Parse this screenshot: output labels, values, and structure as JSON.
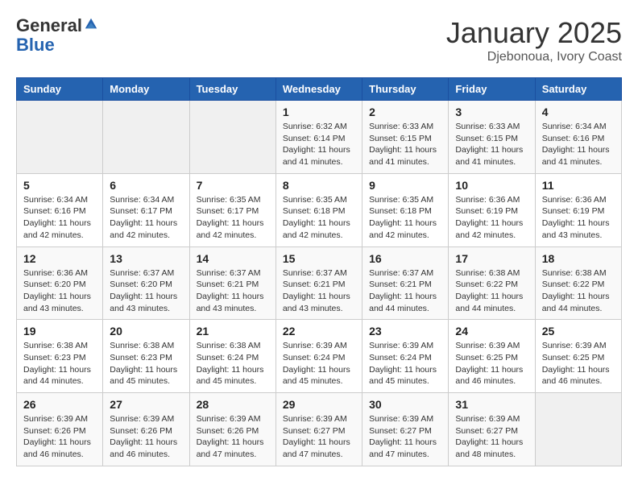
{
  "header": {
    "logo_line1": "General",
    "logo_line2": "Blue",
    "month_title": "January 2025",
    "subtitle": "Djebonoua, Ivory Coast"
  },
  "days_of_week": [
    "Sunday",
    "Monday",
    "Tuesday",
    "Wednesday",
    "Thursday",
    "Friday",
    "Saturday"
  ],
  "weeks": [
    [
      {
        "day": "",
        "info": ""
      },
      {
        "day": "",
        "info": ""
      },
      {
        "day": "",
        "info": ""
      },
      {
        "day": "1",
        "info": "Sunrise: 6:32 AM\nSunset: 6:14 PM\nDaylight: 11 hours\nand 41 minutes."
      },
      {
        "day": "2",
        "info": "Sunrise: 6:33 AM\nSunset: 6:15 PM\nDaylight: 11 hours\nand 41 minutes."
      },
      {
        "day": "3",
        "info": "Sunrise: 6:33 AM\nSunset: 6:15 PM\nDaylight: 11 hours\nand 41 minutes."
      },
      {
        "day": "4",
        "info": "Sunrise: 6:34 AM\nSunset: 6:16 PM\nDaylight: 11 hours\nand 41 minutes."
      }
    ],
    [
      {
        "day": "5",
        "info": "Sunrise: 6:34 AM\nSunset: 6:16 PM\nDaylight: 11 hours\nand 42 minutes."
      },
      {
        "day": "6",
        "info": "Sunrise: 6:34 AM\nSunset: 6:17 PM\nDaylight: 11 hours\nand 42 minutes."
      },
      {
        "day": "7",
        "info": "Sunrise: 6:35 AM\nSunset: 6:17 PM\nDaylight: 11 hours\nand 42 minutes."
      },
      {
        "day": "8",
        "info": "Sunrise: 6:35 AM\nSunset: 6:18 PM\nDaylight: 11 hours\nand 42 minutes."
      },
      {
        "day": "9",
        "info": "Sunrise: 6:35 AM\nSunset: 6:18 PM\nDaylight: 11 hours\nand 42 minutes."
      },
      {
        "day": "10",
        "info": "Sunrise: 6:36 AM\nSunset: 6:19 PM\nDaylight: 11 hours\nand 42 minutes."
      },
      {
        "day": "11",
        "info": "Sunrise: 6:36 AM\nSunset: 6:19 PM\nDaylight: 11 hours\nand 43 minutes."
      }
    ],
    [
      {
        "day": "12",
        "info": "Sunrise: 6:36 AM\nSunset: 6:20 PM\nDaylight: 11 hours\nand 43 minutes."
      },
      {
        "day": "13",
        "info": "Sunrise: 6:37 AM\nSunset: 6:20 PM\nDaylight: 11 hours\nand 43 minutes."
      },
      {
        "day": "14",
        "info": "Sunrise: 6:37 AM\nSunset: 6:21 PM\nDaylight: 11 hours\nand 43 minutes."
      },
      {
        "day": "15",
        "info": "Sunrise: 6:37 AM\nSunset: 6:21 PM\nDaylight: 11 hours\nand 43 minutes."
      },
      {
        "day": "16",
        "info": "Sunrise: 6:37 AM\nSunset: 6:21 PM\nDaylight: 11 hours\nand 44 minutes."
      },
      {
        "day": "17",
        "info": "Sunrise: 6:38 AM\nSunset: 6:22 PM\nDaylight: 11 hours\nand 44 minutes."
      },
      {
        "day": "18",
        "info": "Sunrise: 6:38 AM\nSunset: 6:22 PM\nDaylight: 11 hours\nand 44 minutes."
      }
    ],
    [
      {
        "day": "19",
        "info": "Sunrise: 6:38 AM\nSunset: 6:23 PM\nDaylight: 11 hours\nand 44 minutes."
      },
      {
        "day": "20",
        "info": "Sunrise: 6:38 AM\nSunset: 6:23 PM\nDaylight: 11 hours\nand 45 minutes."
      },
      {
        "day": "21",
        "info": "Sunrise: 6:38 AM\nSunset: 6:24 PM\nDaylight: 11 hours\nand 45 minutes."
      },
      {
        "day": "22",
        "info": "Sunrise: 6:39 AM\nSunset: 6:24 PM\nDaylight: 11 hours\nand 45 minutes."
      },
      {
        "day": "23",
        "info": "Sunrise: 6:39 AM\nSunset: 6:24 PM\nDaylight: 11 hours\nand 45 minutes."
      },
      {
        "day": "24",
        "info": "Sunrise: 6:39 AM\nSunset: 6:25 PM\nDaylight: 11 hours\nand 46 minutes."
      },
      {
        "day": "25",
        "info": "Sunrise: 6:39 AM\nSunset: 6:25 PM\nDaylight: 11 hours\nand 46 minutes."
      }
    ],
    [
      {
        "day": "26",
        "info": "Sunrise: 6:39 AM\nSunset: 6:26 PM\nDaylight: 11 hours\nand 46 minutes."
      },
      {
        "day": "27",
        "info": "Sunrise: 6:39 AM\nSunset: 6:26 PM\nDaylight: 11 hours\nand 46 minutes."
      },
      {
        "day": "28",
        "info": "Sunrise: 6:39 AM\nSunset: 6:26 PM\nDaylight: 11 hours\nand 47 minutes."
      },
      {
        "day": "29",
        "info": "Sunrise: 6:39 AM\nSunset: 6:27 PM\nDaylight: 11 hours\nand 47 minutes."
      },
      {
        "day": "30",
        "info": "Sunrise: 6:39 AM\nSunset: 6:27 PM\nDaylight: 11 hours\nand 47 minutes."
      },
      {
        "day": "31",
        "info": "Sunrise: 6:39 AM\nSunset: 6:27 PM\nDaylight: 11 hours\nand 48 minutes."
      },
      {
        "day": "",
        "info": ""
      }
    ]
  ]
}
